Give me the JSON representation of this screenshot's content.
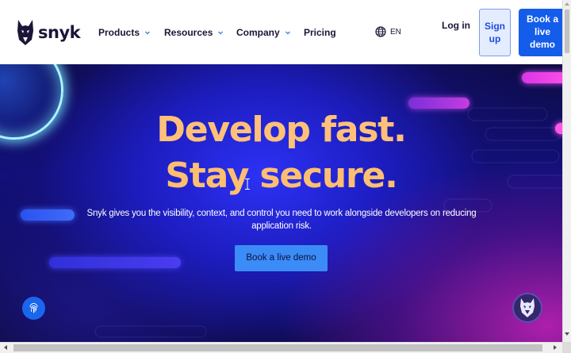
{
  "brand": {
    "name": "snyk",
    "logo_icon": "doberman-dog-logo"
  },
  "nav": {
    "items": [
      {
        "label": "Products",
        "has_dropdown": true
      },
      {
        "label": "Resources",
        "has_dropdown": true
      },
      {
        "label": "Company",
        "has_dropdown": true
      },
      {
        "label": "Pricing",
        "has_dropdown": false
      }
    ],
    "language": {
      "code": "EN",
      "icon": "globe-icon"
    }
  },
  "header_actions": {
    "login_label": "Log in",
    "signup_label": "Sign up",
    "demo_label": "Book a live demo"
  },
  "hero": {
    "headline_line1": "Develop fast.",
    "headline_line2": "Stay secure.",
    "subtitle": "Snyk gives you the visibility, context, and control you need to work alongside developers on reducing application risk.",
    "cta_label": "Book a live demo"
  },
  "widgets": {
    "left_icon": "fingerprint-icon",
    "right_icon": "snyk-chat-icon"
  },
  "colors": {
    "header_bg": "#ffffff",
    "nav_text": "#1b1537",
    "accent_blue": "#145dea",
    "signup_bg": "#e4ecff",
    "headline": "#ffbf70",
    "cta_bg": "#3b8cf6",
    "hero_magenta": "#c923be"
  }
}
